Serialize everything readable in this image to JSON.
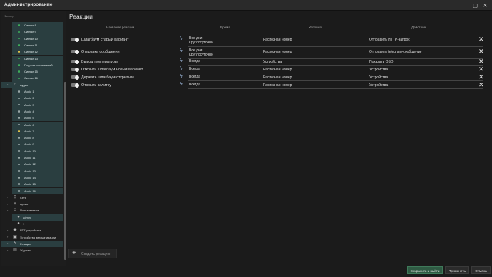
{
  "window": {
    "title": "Администрирование"
  },
  "sidebar": {
    "search_placeholder": "Фильтр",
    "items": [
      {
        "label": "Сигнал 8",
        "kind": "signal",
        "dot": "#3fae5a",
        "teal": true
      },
      {
        "label": "Сигнал 9",
        "kind": "signal",
        "dot": "#3fae5a",
        "teal": true
      },
      {
        "label": "Сигнал 10",
        "kind": "signal",
        "dot": "#3fae5a",
        "teal": true
      },
      {
        "label": "Сигнал 11",
        "kind": "signal",
        "dot": "#3fae5a",
        "teal": true
      },
      {
        "label": "Сигнал 12",
        "kind": "signal",
        "dot": "#e0c24a",
        "teal": true
      },
      {
        "label": "Сигнал 13",
        "kind": "signal",
        "dot": "#3fae5a",
        "teal": true
      },
      {
        "label": "Подсчет посетителей",
        "kind": "signal",
        "dot": "#3fae5a",
        "teal": true
      },
      {
        "label": "Сигнал 15",
        "kind": "signal",
        "dot": "#3fae5a",
        "teal": true
      },
      {
        "label": "Сигнал 16",
        "kind": "signal",
        "dot": "#3fae5a",
        "teal": true
      },
      {
        "label": "Аудио",
        "kind": "group",
        "icon": "audio-icon",
        "teal": true
      },
      {
        "label": "Audio 1",
        "kind": "audio",
        "dot": "#9aa8a8",
        "teal": true
      },
      {
        "label": "Audio 2",
        "kind": "audio",
        "dot": "#9aa8a8",
        "teal": true
      },
      {
        "label": "Audio 3",
        "kind": "audio",
        "dot": "#9aa8a8",
        "teal": true
      },
      {
        "label": "Audio 4",
        "kind": "audio",
        "dot": "#9aa8a8",
        "teal": true
      },
      {
        "label": "Audio 5",
        "kind": "audio",
        "dot": "#9aa8a8",
        "teal": true
      },
      {
        "label": "Audio 6",
        "kind": "audio",
        "dot": "#9aa8a8",
        "teal": true
      },
      {
        "label": "Audio 7",
        "kind": "audio",
        "dot": "#e0c24a",
        "teal": true
      },
      {
        "label": "Audio 8",
        "kind": "audio",
        "dot": "#9aa8a8",
        "teal": true
      },
      {
        "label": "Audio 9",
        "kind": "audio",
        "dot": "#9aa8a8",
        "teal": true
      },
      {
        "label": "Audio 10",
        "kind": "audio",
        "dot": "#9aa8a8",
        "teal": true
      },
      {
        "label": "Audio 11",
        "kind": "audio",
        "dot": "#9aa8a8",
        "teal": true
      },
      {
        "label": "Audio 12",
        "kind": "audio",
        "dot": "#9aa8a8",
        "teal": true
      },
      {
        "label": "Audio 13",
        "kind": "audio",
        "dot": "#9aa8a8",
        "teal": true
      },
      {
        "label": "Audio 14",
        "kind": "audio",
        "dot": "#9aa8a8",
        "teal": true
      },
      {
        "label": "Audio 15",
        "kind": "audio",
        "dot": "#9aa8a8",
        "teal": true
      },
      {
        "label": "Audio 16",
        "kind": "audio",
        "dot": "#9aa8a8",
        "teal": true
      },
      {
        "label": "Сеть",
        "kind": "group",
        "icon": "network-icon",
        "teal": false
      },
      {
        "label": "Архив",
        "kind": "group",
        "icon": "archive-icon",
        "teal": false
      },
      {
        "label": "Пользователи",
        "kind": "group",
        "icon": "users-icon",
        "teal": false
      },
      {
        "label": "admin",
        "kind": "user",
        "icon": "user-icon",
        "teal": true
      },
      {
        "label": "1",
        "kind": "user",
        "icon": "user-icon",
        "teal": false
      },
      {
        "label": "PTZ-устройства",
        "kind": "group",
        "icon": "ptz-icon",
        "teal": false
      },
      {
        "label": "Устройства автоматизации",
        "kind": "group",
        "icon": "automation-icon",
        "teal": false
      },
      {
        "label": "Реакции",
        "kind": "group",
        "icon": "lightning-icon",
        "teal": true,
        "selected": true
      },
      {
        "label": "Журнал",
        "kind": "group",
        "icon": "journal-icon",
        "teal": false
      }
    ]
  },
  "main": {
    "title": "Реакции",
    "columns": {
      "name": "Название реакции",
      "time": "Время",
      "conditions": "Условия",
      "action": "Действие"
    },
    "rows": [
      {
        "name": "Шлагбаум старый вариант",
        "time": [
          "Все дни",
          "Круглосуточно"
        ],
        "condition": "Распознан номер",
        "action": "Отправить HTTP-запрос"
      },
      {
        "name": "Отправка сообщения",
        "time": [
          "Все дни",
          "Круглосуточно"
        ],
        "condition": "Распознан номер",
        "action": "Отправить telegram-сообщение"
      },
      {
        "name": "Вывод температуры",
        "time": [
          "Всегда"
        ],
        "condition": "Устройства",
        "action": "Показать OSD"
      },
      {
        "name": "Открыть шлагбаум новый вариант",
        "time": [
          "Всегда"
        ],
        "condition": "Распознан номер",
        "action": "Устройства"
      },
      {
        "name": "Держать шлагбаум открытым",
        "time": [
          "Всегда"
        ],
        "condition": "Распознан номер",
        "action": "Устройства"
      },
      {
        "name": "Открыть калитку",
        "time": [
          "Всегда"
        ],
        "condition": "Распознан номер",
        "action": "Устройства"
      }
    ],
    "add_label": "Создать реакцию"
  },
  "footer": {
    "save_exit": "Сохранить и выйти",
    "apply": "Применить",
    "cancel": "Отмена"
  },
  "colors": {
    "accent": "#2f5a43",
    "tree_highlight": "#2a3e40",
    "bolt": "#8fa8c8"
  }
}
